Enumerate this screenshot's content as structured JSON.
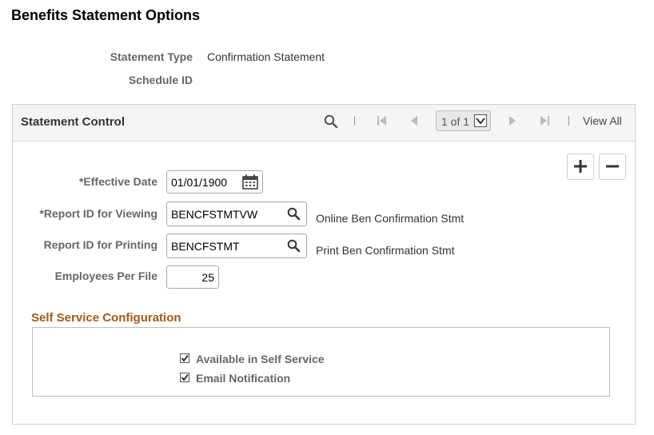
{
  "page": {
    "title": "Benefits Statement Options"
  },
  "header": {
    "statement_type_label": "Statement Type",
    "statement_type_value": "Confirmation Statement",
    "schedule_id_label": "Schedule ID",
    "schedule_id_value": ""
  },
  "statement_control": {
    "title": "Statement Control",
    "pager_text": "1 of 1",
    "view_all": "View All",
    "icons": [
      "search-icon",
      "first-page-icon",
      "previous-icon",
      "next-icon",
      "last-page-icon",
      "add-row-icon",
      "delete-row-icon",
      "calendar-icon",
      "lookup-icon"
    ],
    "fields": {
      "effective_date_label": "*Effective Date",
      "effective_date_value": "01/01/1900",
      "report_view_label": "*Report ID for Viewing",
      "report_view_value": "BENCFSTMTVW",
      "report_view_desc": "Online Ben Confirmation Stmt",
      "report_print_label": "Report ID for Printing",
      "report_print_value": "BENCFSTMT",
      "report_print_desc": "Print Ben Confirmation Stmt",
      "employees_label": "Employees Per File",
      "employees_value": "25"
    }
  },
  "self_service": {
    "title": "Self Service Configuration",
    "available_label": "Available in Self Service",
    "available_checked": true,
    "email_label": "Email Notification",
    "email_checked": true
  },
  "colors": {
    "section_title": "#a35a16",
    "label": "#666666"
  }
}
